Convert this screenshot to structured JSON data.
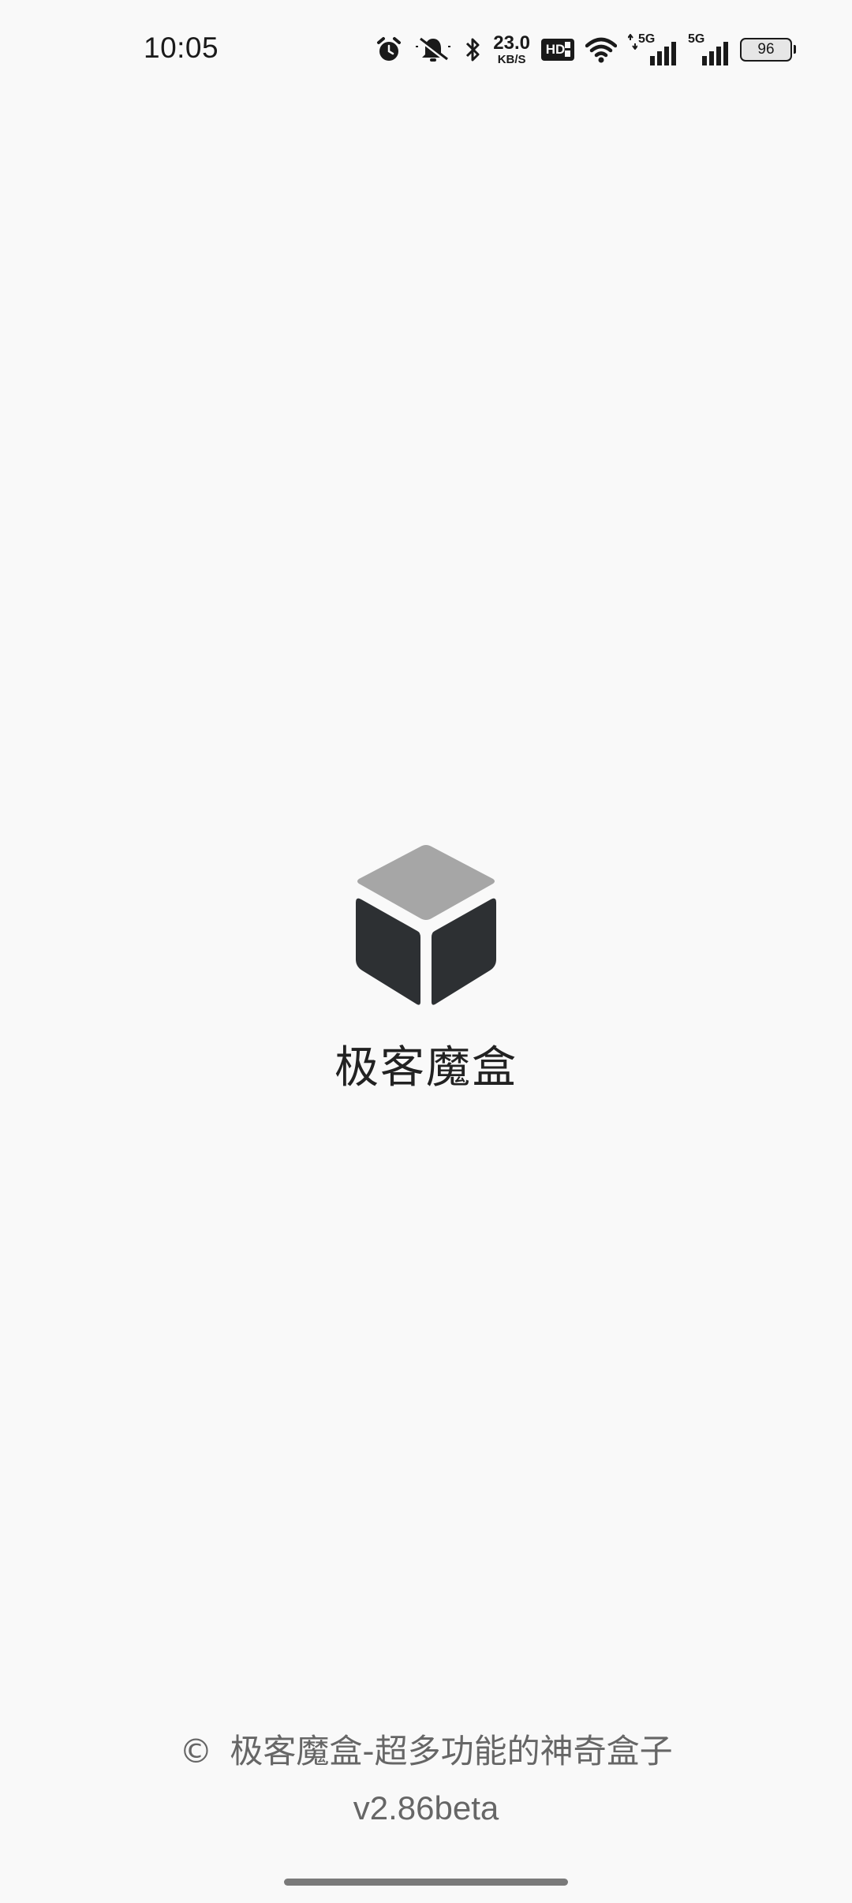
{
  "status_bar": {
    "time": "10:05",
    "net_speed_value": "23.0",
    "net_speed_unit": "KB/S",
    "hd_label": "HD",
    "signal1_label": "5G",
    "signal2_label": "5G",
    "battery_level": "96",
    "icons": [
      "alarm-icon",
      "mute-icon",
      "bluetooth-icon",
      "hd-voice-icon",
      "wifi-icon",
      "signal-5g-icon",
      "signal-5g-icon",
      "battery-icon"
    ]
  },
  "app": {
    "name": "极客魔盒",
    "logo": "cube-logo-icon",
    "colors": {
      "cube_top": "#a6a6a6",
      "cube_sides": "#2d3033"
    }
  },
  "footer": {
    "copyright_symbol": "©",
    "tagline": "极客魔盒-超多功能的神奇盒子",
    "version": "v2.86beta"
  }
}
